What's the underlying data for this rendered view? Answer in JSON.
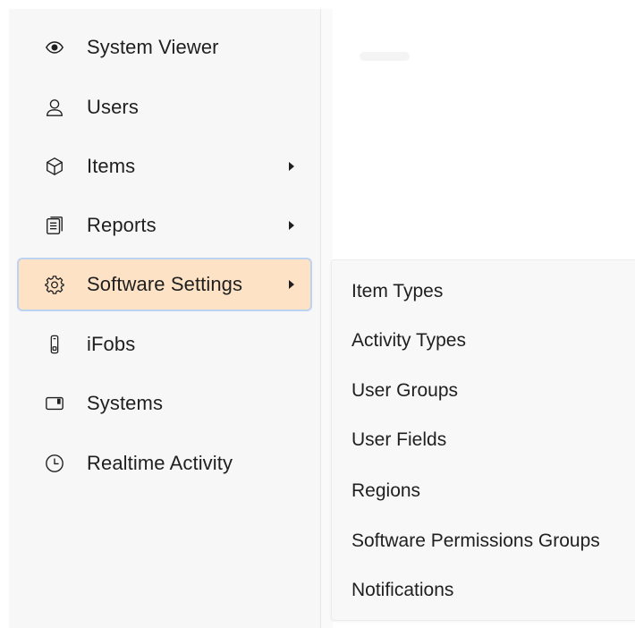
{
  "sidebar": {
    "items": [
      {
        "label": "System Viewer",
        "icon": "eye-icon",
        "has_submenu": false
      },
      {
        "label": "Users",
        "icon": "user-icon",
        "has_submenu": false
      },
      {
        "label": "Items",
        "icon": "cube-icon",
        "has_submenu": true
      },
      {
        "label": "Reports",
        "icon": "report-icon",
        "has_submenu": true
      },
      {
        "label": "Software Settings",
        "icon": "gear-icon",
        "has_submenu": true,
        "active": true
      },
      {
        "label": "iFobs",
        "icon": "fob-icon",
        "has_submenu": false
      },
      {
        "label": "Systems",
        "icon": "system-icon",
        "has_submenu": false
      },
      {
        "label": "Realtime Activity",
        "icon": "clock-icon",
        "has_submenu": false
      }
    ]
  },
  "submenu": {
    "items": [
      {
        "label": "Item Types"
      },
      {
        "label": "Activity Types"
      },
      {
        "label": "User Groups"
      },
      {
        "label": "User Fields"
      },
      {
        "label": "Regions"
      },
      {
        "label": "Software Permissions Groups"
      },
      {
        "label": "Notifications"
      }
    ]
  },
  "colors": {
    "active_bg": "#fde2c6",
    "active_border": "#bcd4f2",
    "sidebar_bg": "#f7f7f7",
    "text": "#1f1f1f"
  }
}
